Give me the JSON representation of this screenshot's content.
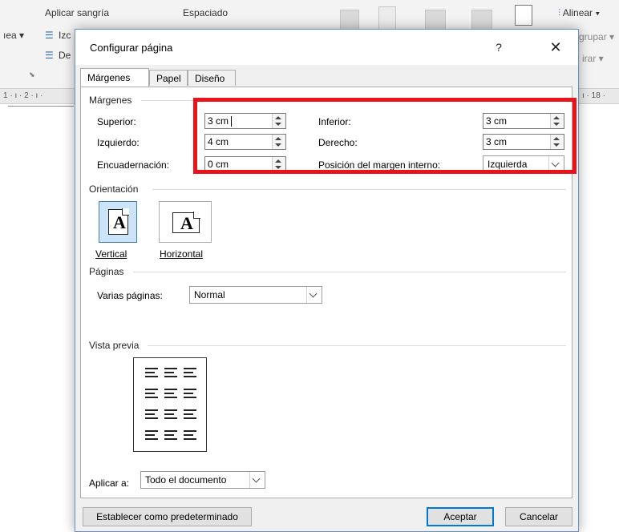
{
  "ribbon": {
    "aplicar_sangria": "Aplicar sangría",
    "espaciado": "Espaciado",
    "alinear": "Alinear",
    "agrupar": "grupar",
    "girar": "irar",
    "left_fragment": "ıea",
    "izq_fragment": "Izc",
    "de_fragment": "De",
    "ruler_left": "1 · ı · 2 · ı ·",
    "ruler_right": "ı · 18 ·"
  },
  "dialog": {
    "title": "Configurar página",
    "help": "?",
    "close": "✕",
    "tabs": [
      "Márgenes",
      "Papel",
      "Diseño"
    ],
    "margins": {
      "heading": "Márgenes",
      "superior_label": "Superior:",
      "superior_value": "3 cm",
      "inferior_label": "Inferior:",
      "inferior_value": "3 cm",
      "izquierdo_label": "Izquierdo:",
      "izquierdo_value": "4 cm",
      "derecho_label": "Derecho:",
      "derecho_value": "3 cm",
      "encuadernacion_label": "Encuadernación:",
      "encuadernacion_value": "0 cm",
      "posicion_label": "Posición del margen interno:",
      "posicion_value": "Izquierda"
    },
    "orientation": {
      "heading": "Orientación",
      "vertical": "Vertical",
      "horizontal": "Horizontal"
    },
    "pages": {
      "heading": "Páginas",
      "varias_label": "Varias páginas:",
      "varias_value": "Normal"
    },
    "preview": {
      "heading": "Vista previa"
    },
    "apply": {
      "label": "Aplicar a:",
      "value": "Todo el documento"
    },
    "buttons": {
      "default": "Establecer como predeterminado",
      "ok": "Aceptar",
      "cancel": "Cancelar"
    }
  },
  "colors": {
    "highlight": "#e8141a",
    "accent": "#0078d7"
  }
}
